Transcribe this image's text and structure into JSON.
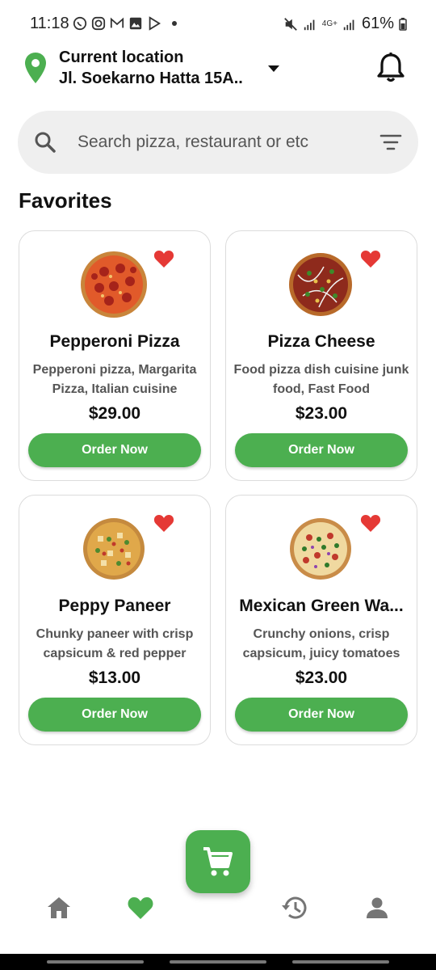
{
  "status_bar": {
    "time": "11:18",
    "battery": "61%",
    "network": "4G+"
  },
  "header": {
    "location_title": "Current location",
    "location_address": "Jl. Soekarno Hatta 15A.."
  },
  "search": {
    "placeholder": "Search pizza, restaurant or etc"
  },
  "favorites": {
    "title": "Favorites",
    "items": [
      {
        "name": "Pepperoni Pizza",
        "description": "Pepperoni pizza, Margarita Pizza, Italian cuisine",
        "price": "$29.00",
        "button": "Order Now"
      },
      {
        "name": "Pizza Cheese",
        "description": "Food pizza dish cuisine junk food, Fast Food",
        "price": "$23.00",
        "button": "Order Now"
      },
      {
        "name": "Peppy Paneer",
        "description": "Chunky paneer with crisp capsicum & red pepper",
        "price": "$13.00",
        "button": "Order Now"
      },
      {
        "name": "Mexican Green Wa...",
        "description": "Crunchy onions, crisp capsicum, juicy tomatoes",
        "price": "$23.00",
        "button": "Order Now"
      }
    ]
  },
  "bottom_nav": {
    "items": [
      "home-icon",
      "heart-icon",
      "cart-icon",
      "history-icon",
      "profile-icon"
    ],
    "active": "heart-icon"
  },
  "colors": {
    "accent": "#4caf50",
    "heart": "#e53935",
    "search_bg": "#efefef"
  }
}
